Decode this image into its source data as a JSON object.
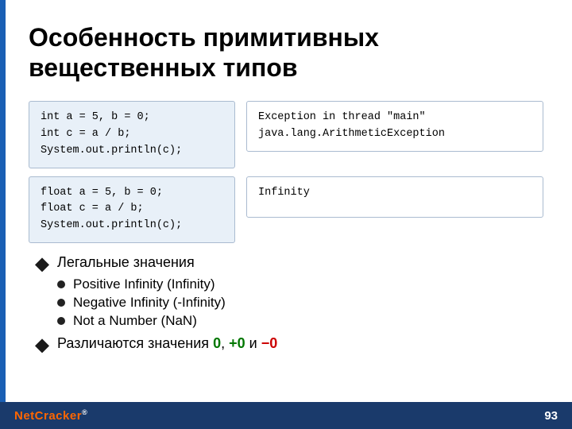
{
  "title": "Особенность примитивных вещественных типов",
  "code_block_1": {
    "code": "int a = 5, b = 0;\nint c = a / b;\nSystem.out.println(c);",
    "output": "Exception in thread \"main\"\njava.lang.ArithmeticException"
  },
  "code_block_2": {
    "code": "float a = 5, b = 0;\nfloat c = a / b;\nSystem.out.println(c);",
    "output": "Infinity"
  },
  "bullets": {
    "main1": "Легальные значения",
    "sub1": "Positive Infinity (Infinity)",
    "sub2": "Negative Infinity (-Infinity)",
    "sub3": "Not a Number (NaN)",
    "main2_prefix": "Различаются значения ",
    "main2_val1": "0",
    "main2_sep1": ", ",
    "main2_val2": "+0",
    "main2_sep2": " и ",
    "main2_val3": "−0"
  },
  "footer": {
    "logo_net": "Net",
    "logo_cracker": "Cracker",
    "page_number": "93"
  }
}
